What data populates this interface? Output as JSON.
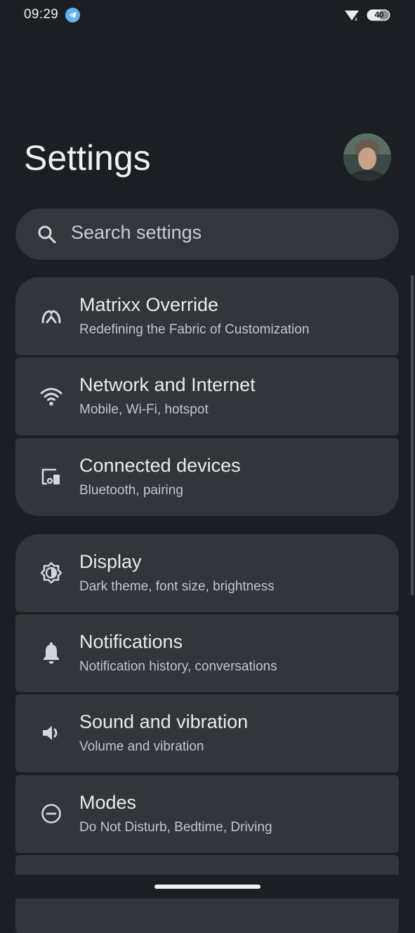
{
  "status_bar": {
    "time": "09:29",
    "battery": "40",
    "icons": [
      "telegram-icon",
      "wifi-icon",
      "battery-icon"
    ]
  },
  "header": {
    "title": "Settings",
    "avatar": "profile-avatar"
  },
  "search": {
    "placeholder": "Search settings",
    "icon": "search-icon"
  },
  "settings_groups": [
    {
      "items": [
        {
          "icon": "matrixx-icon",
          "title": "Matrixx Override",
          "subtitle": "Redefining the Fabric of Customization"
        },
        {
          "icon": "wifi-icon",
          "title": "Network and Internet",
          "subtitle": "Mobile, Wi-Fi, hotspot"
        },
        {
          "icon": "devices-icon",
          "title": "Connected devices",
          "subtitle": "Bluetooth, pairing"
        }
      ]
    },
    {
      "items": [
        {
          "icon": "brightness-icon",
          "title": "Display",
          "subtitle": "Dark theme, font size, brightness"
        },
        {
          "icon": "bell-icon",
          "title": "Notifications",
          "subtitle": "Notification history, conversations"
        },
        {
          "icon": "speaker-icon",
          "title": "Sound and vibration",
          "subtitle": "Volume and vibration"
        },
        {
          "icon": "do-not-disturb-icon",
          "title": "Modes",
          "subtitle": "Do Not Disturb, Bedtime, Driving"
        }
      ]
    }
  ],
  "colors": {
    "background": "#1b1f23",
    "card": "#32363b",
    "search_bg": "#33373c",
    "text_primary": "#e9ebee",
    "text_secondary": "#c2c5ca",
    "telegram_accent": "#5fb6ef"
  }
}
